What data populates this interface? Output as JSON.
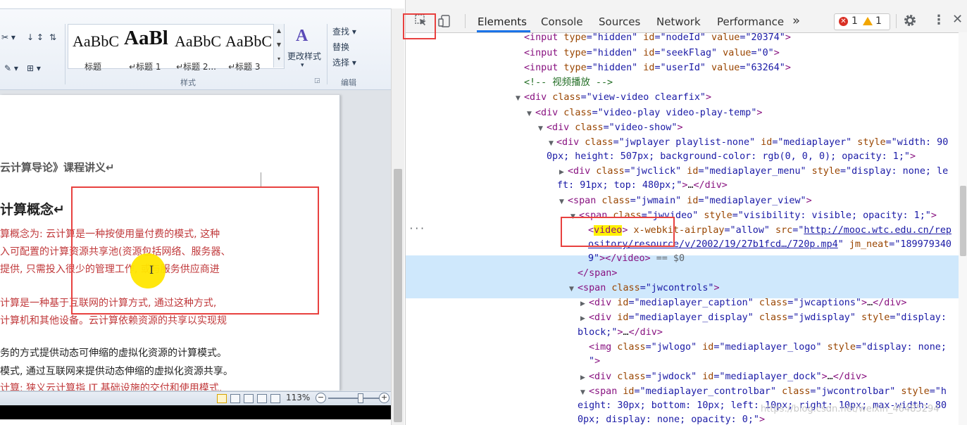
{
  "word": {
    "ribbon": {
      "small_icons": [
        "✂ ▾",
        "↓ ↕",
        "⇅",
        "✎ ▾",
        "⊞ ▾"
      ],
      "styles": [
        {
          "sample": "AaBbC",
          "name": "标题"
        },
        {
          "sample": "AaBl",
          "name": "↵标题 1"
        },
        {
          "sample": "AaBbC",
          "name": "↵标题 2..."
        },
        {
          "sample": "AaBbC",
          "name": "↵标题 3"
        }
      ],
      "change_styles_label": "更改样式",
      "styles_group_label": "样式",
      "editing_group_label": "编辑",
      "find_label": "查找 ▾",
      "replace_label": "替换",
      "select_label": "选择 ▾"
    },
    "document": {
      "lines": [
        {
          "text": "云计算导论》课程讲义↵",
          "style": "dark"
        },
        {
          "text": "计算概念↵",
          "style": "heading"
        },
        {
          "text": "算概念为: 云计算是一种按使用量付费的模式, 这种",
          "style": "red"
        },
        {
          "text": "入可配置的计算资源共享池(资源包括网络、服务器、",
          "style": "red"
        },
        {
          "text": "提供, 只需投入很少的管理工作, 或与服务供应商进",
          "style": "red"
        },
        {
          "text": "计算是一种基于互联网的计算方式, 通过这种方式,",
          "style": "red"
        },
        {
          "text": "计算机和其他设备。云计算依赖资源的共享以实现规",
          "style": "red"
        },
        {
          "text": "务的方式提供动态可伸缩的虚拟化资源的计算模式。",
          "style": "dark"
        },
        {
          "text": "模式, 通过互联网来提供动态伸缩的虚拟化资源共享。",
          "style": "dark"
        },
        {
          "text": "计算: 狭义云计算指 IT 基础设施的交付和使用模式,",
          "style": "red"
        }
      ]
    },
    "status": {
      "zoom": "113%",
      "zoom_level_percent": 58
    }
  },
  "devtools": {
    "tabs": [
      "Elements",
      "Console",
      "Sources",
      "Network",
      "Performance"
    ],
    "active_tab": "Elements",
    "more_tabs": "»",
    "errors": "1",
    "warnings": "1",
    "dom_lines": {
      "l1": {
        "t1": "<input",
        "a1": " type",
        "v1": "=\"hidden\"",
        "a2": " id",
        "v2": "=\"nodeId\"",
        "a3": " value",
        "v3": "=\"20374\"",
        "t2": ">"
      },
      "l2": {
        "t1": "<input",
        "a1": " type",
        "v1": "=\"hidden\"",
        "a2": " id",
        "v2": "=\"seekFlag\"",
        "a3": " value",
        "v3": "=\"0\"",
        "t2": ">"
      },
      "l3": {
        "t1": "<input",
        "a1": " type",
        "v1": "=\"hidden\"",
        "a2": " id",
        "v2": "=\"userId\"",
        "a3": " value",
        "v3": "=\"63264\"",
        "t2": ">"
      },
      "l4": {
        "text": "<!-- 视频播放 -->"
      },
      "l5": {
        "t1": "<div",
        "a1": " class",
        "v1": "=\"view-video clearfix\"",
        "t2": ">"
      },
      "l6": {
        "t1": "<div",
        "a1": " class",
        "v1": "=\"video-play video-play-temp\"",
        "t2": ">"
      },
      "l7": {
        "t1": "<div",
        "a1": " class",
        "v1": "=\"video-show\"",
        "t2": ">"
      },
      "l8": {
        "t1": "<div",
        "a1": " class",
        "v1": "=\"jwplayer playlist-none\"",
        "a2": " id",
        "v2": "=\"mediaplayer\"",
        "a3": " style",
        "v3": "=\"width: 90"
      },
      "l8b": {
        "v1": "0px; height: 507px; background-color: rgb(0, 0, 0); opacity: 1;\"",
        "t2": ">"
      },
      "l9": {
        "t1": "<div",
        "a1": " class",
        "v1": "=\"jwclick\"",
        "a2": " id",
        "v2": "=\"mediaplayer_menu\"",
        "a3": " style",
        "v3": "=\"display: none; le"
      },
      "l9b": {
        "v1": "ft: 91px; top: 480px;\"",
        "t2": ">",
        "x": "…",
        "t3": "</div>"
      },
      "l10": {
        "t1": "<span",
        "a1": " class",
        "v1": "=\"jwmain\"",
        "a2": " id",
        "v2": "=\"mediaplayer_view\"",
        "t2": ">"
      },
      "l11": {
        "t1": "<span",
        "a1": " class",
        "v1": "=\"jwvideo\"",
        "a2": " style",
        "v2": "=\"visibility: visible; opacity: 1;\"",
        "t2": ">"
      },
      "l12": {
        "t0": "<",
        "hl": "video",
        "a1": " x-webkit-airplay",
        "v1": "=\"allow\"",
        "a2": " src",
        "v2": "=\"",
        "lk": "http://mooc.wtc.edu.cn/rep"
      },
      "l12b": {
        "lk": "ository/resource/v/2002/19/27b1fcd…/720p.mp4",
        "v1": "\"",
        "a1": " jm_neat",
        "v2": "=\"189979340"
      },
      "l12c": {
        "v1": "9\"",
        "t1": "></video>",
        "x": " == $0"
      },
      "l13": {
        "t1": "</span>"
      },
      "l14": {
        "t1": "<span",
        "a1": " class",
        "v1": "=\"jwcontrols\"",
        "t2": ">"
      },
      "l15": {
        "t1": "<div",
        "a1": " id",
        "v1": "=\"mediaplayer_caption\"",
        "a2": " class",
        "v2": "=\"jwcaptions\"",
        "t2": ">",
        "x": "…",
        "t3": "</div>"
      },
      "l16": {
        "t1": "<div",
        "a1": " id",
        "v1": "=\"mediaplayer_display\"",
        "a2": " class",
        "v2": "=\"jwdisplay\"",
        "a3": " style",
        "v3": "=\"display:"
      },
      "l16b": {
        "v1": "block;\"",
        "t2": ">",
        "x": "…",
        "t3": "</div>"
      },
      "l17": {
        "t1": "<img",
        "a1": " class",
        "v1": "=\"jwlogo\"",
        "a2": " id",
        "v2": "=\"mediaplayer_logo\"",
        "a3": " style",
        "v3": "=\"display: none;"
      },
      "l17b": {
        "v1": "\"",
        "t2": ">"
      },
      "l18": {
        "t1": "<div",
        "a1": " class",
        "v1": "=\"jwdock\"",
        "a2": " id",
        "v2": "=\"mediaplayer_dock\"",
        "t2": ">",
        "x": "…",
        "t3": "</div>"
      },
      "l19": {
        "t1": "<span",
        "a1": " id",
        "v1": "=\"mediaplayer_controlbar\"",
        "a2": " class",
        "v2": "=\"jwcontrolbar\"",
        "a3": " style",
        "v3": "=\"h"
      },
      "l19b": {
        "v1": "eight: 30px; bottom: 10px; left: 10px; right: 10px; max-width: 80"
      },
      "l19c": {
        "v1": "0px; display: none; opacity: 0;\"",
        "t2": ">"
      }
    },
    "ellipsis_marker": "···"
  },
  "watermark": "https://blog.csdn.net/weixin_46485294",
  "colors": {
    "highlight_box": "#e8413f",
    "selected_row": "#cfe8fc",
    "active_tab": "#1a73e8"
  }
}
